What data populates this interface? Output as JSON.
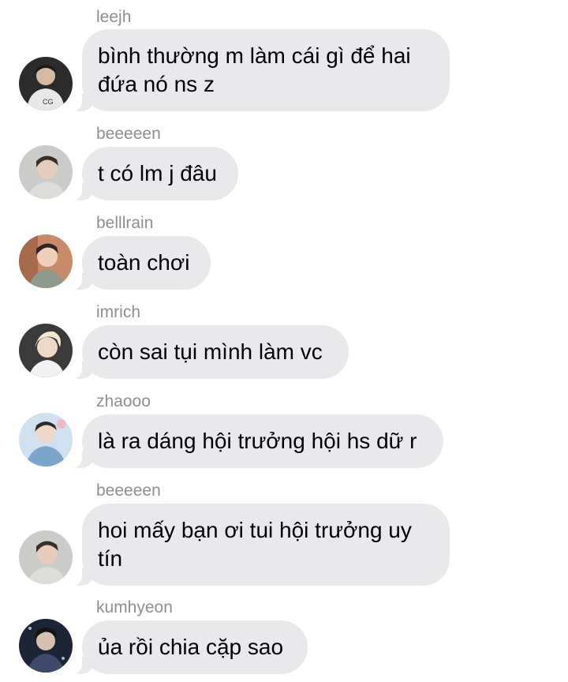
{
  "messages": [
    {
      "sender": "leejh",
      "text": "bình thường m làm cái gì để hai đứa nó ns z",
      "avatar": "avatar-leejh"
    },
    {
      "sender": "beeeeen",
      "text": "t có lm j đâu",
      "avatar": "avatar-beeeeen"
    },
    {
      "sender": "belllrain",
      "text": "toàn chơi",
      "avatar": "avatar-belllrain"
    },
    {
      "sender": "imrich",
      "text": "còn sai tụi mình làm vc",
      "avatar": "avatar-imrich"
    },
    {
      "sender": "zhaooo",
      "text": "là ra dáng hội trưởng hội hs dữ r",
      "avatar": "avatar-zhaooo"
    },
    {
      "sender": "beeeeen",
      "text": "hoi mấy bạn ơi tui hội trưởng uy tín",
      "avatar": "avatar-beeeeen"
    },
    {
      "sender": "kumhyeon",
      "text": "ủa rồi chia cặp sao",
      "avatar": "avatar-kumhyeon"
    }
  ]
}
